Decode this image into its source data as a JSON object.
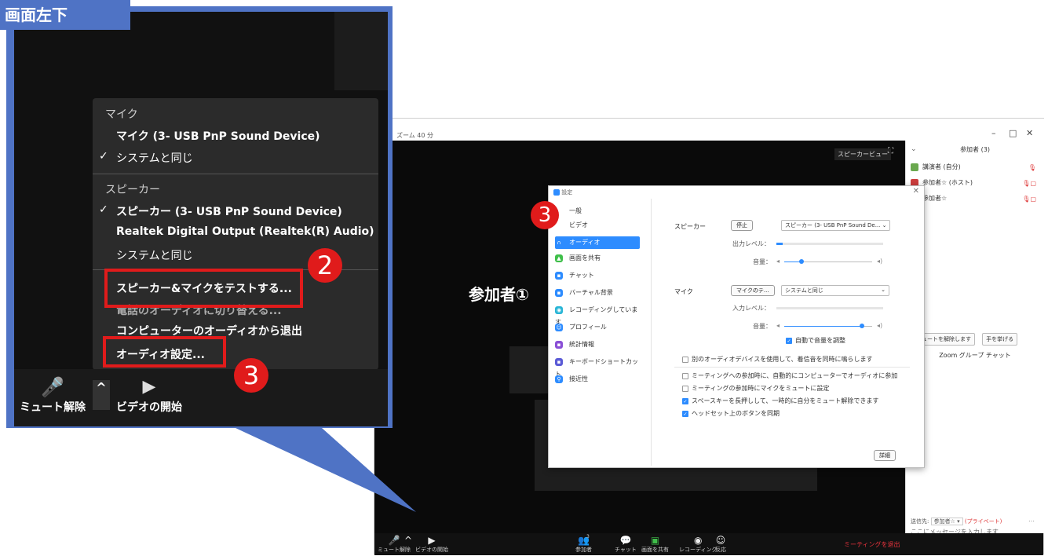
{
  "callout": {
    "tag": "画面左下",
    "menu": {
      "mic_header": "マイク",
      "mic_items": [
        "マイク (3- USB PnP Sound Device)",
        "システムと同じ"
      ],
      "speaker_header": "スピーカー",
      "speaker_items": [
        "スピーカー (3- USB PnP Sound Device)",
        "Realtek Digital Output (Realtek(R) Audio)",
        "システムと同じ"
      ],
      "actions": [
        "スピーカー&マイクをテストする...",
        "電話のオーディオに切り替える...",
        "コンピューターのオーディオから退出",
        "オーディオ設定..."
      ]
    },
    "bar": {
      "mute": "ミュート解除",
      "video": "ビデオの開始"
    },
    "badges": {
      "two": "2",
      "three": "3"
    }
  },
  "zoom": {
    "window_title": "ズーム 40 分",
    "speaker_view": "スピーカービュー",
    "participant_label": "参加者①",
    "bottom_bar": {
      "mute": "ミュート解除",
      "video": "ビデオの開始",
      "participants": "参加者",
      "participants_count": "3",
      "chat": "チャット",
      "share": "画面を共有",
      "record": "レコーディング",
      "reactions": "反応",
      "leave": "ミーティングを退出"
    },
    "panel": {
      "title": "参加者 (3)",
      "participants": [
        "講演者 (自分)",
        "参加者☆ (ホスト)",
        "参加者☆"
      ],
      "unmute_all": "ミュートを解除します",
      "raise_hand": "手を挙げる",
      "chat_title": "Zoom グループ チャット",
      "send_to_label": "送信先:",
      "send_to_value": "参加者☆ ▾",
      "private": "(プライベート)",
      "chat_placeholder": "ここにメッセージを入力します..."
    }
  },
  "settings": {
    "title": "設定",
    "badge": "3",
    "sidebar": [
      "一般",
      "ビデオ",
      "オーディオ",
      "画面を共有",
      "チャット",
      "バーチャル背景",
      "レコーディングしています",
      "プロフィール",
      "統計情報",
      "キーボードショートカット",
      "接近性"
    ],
    "speaker_label": "スピーカー",
    "stop_button": "停止",
    "speaker_select": "スピーカー (3- USB PnP Sound De...",
    "output_level": "出力レベル：",
    "volume_label": "音量：",
    "mic_label": "マイク",
    "mic_test_button": "マイクのテ...",
    "mic_select": "システムと同じ",
    "input_level": "入力レベル：",
    "auto_adjust": "自動で音量を調整",
    "separate_device": "別のオーディオデバイスを使用して、着信音を同時に鳴らします",
    "options": [
      {
        "label": "ミーティングへの参加時に、自動的にコンピューターでオーディオに参加",
        "checked": false
      },
      {
        "label": "ミーティングの参加時にマイクをミュートに設定",
        "checked": false
      },
      {
        "label": "スペースキーを長押しして、一時的に自分をミュート解除できます",
        "checked": true
      },
      {
        "label": "ヘッドセット上のボタンを同期",
        "checked": true
      }
    ],
    "details_button": "詳細",
    "output_level_value": 0.06,
    "speaker_volume_value": 0.2,
    "mic_volume_value": 0.88,
    "accent": "#2d8cff"
  }
}
